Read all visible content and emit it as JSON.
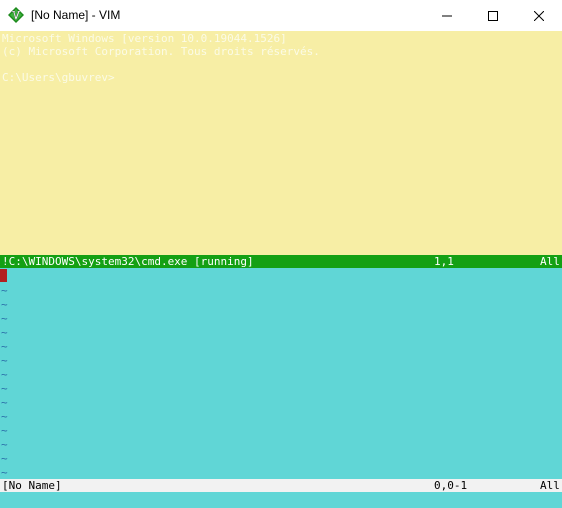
{
  "window": {
    "title": "[No Name] - VIM",
    "icon": "vim-icon",
    "controls": {
      "minimize": "minimize-icon",
      "maximize": "maximize-icon",
      "close": "close-icon"
    }
  },
  "terminal": {
    "lines": [
      "Microsoft Windows [version 10.0.19044.1526]",
      "(c) Microsoft Corporation. Tous droits réservés.",
      "",
      "C:\\Users\\gbuvrev>"
    ],
    "status": {
      "name": "!C:\\WINDOWS\\system32\\cmd.exe [running]",
      "position": "1,1",
      "percent": "All"
    }
  },
  "buffer": {
    "tilde": "~",
    "tilde_count": 14,
    "status": {
      "name": "[No Name]",
      "position": "0,0-1",
      "percent": "All"
    }
  },
  "colors": {
    "terminal_bg": "#f7eea5",
    "terminal_status_bg": "#14a014",
    "buffer_bg": "#60d6d6",
    "cursor": "#b32020",
    "tilde": "#2a6ea8"
  }
}
